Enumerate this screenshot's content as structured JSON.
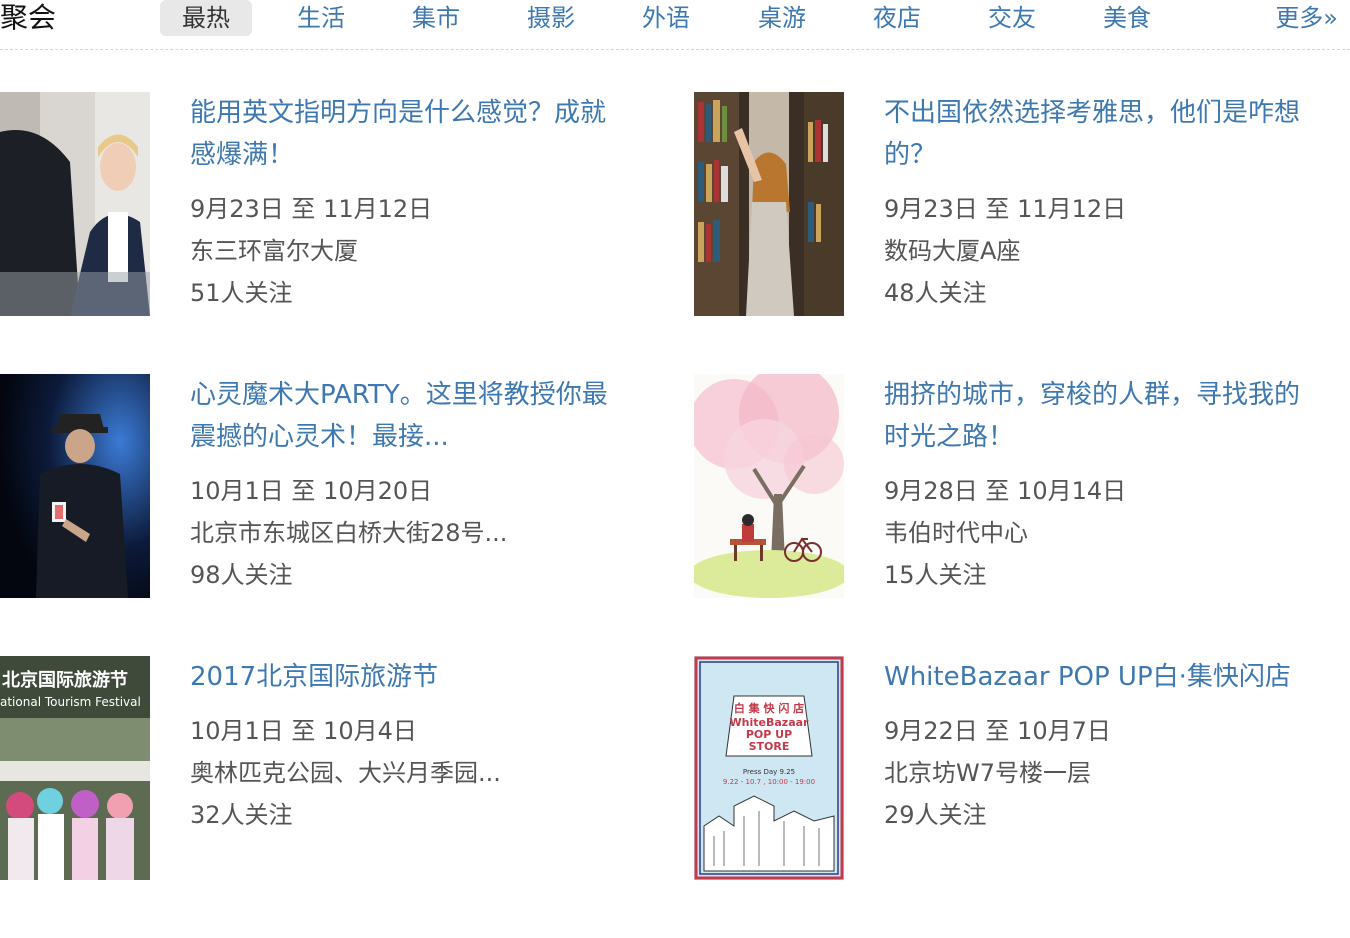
{
  "header": {
    "brand": "聚会",
    "tabs": [
      {
        "label": "最热",
        "active": true
      },
      {
        "label": "生活"
      },
      {
        "label": "集市"
      },
      {
        "label": "摄影"
      },
      {
        "label": "外语"
      },
      {
        "label": "桌游"
      },
      {
        "label": "夜店"
      },
      {
        "label": "交友"
      },
      {
        "label": "美食"
      }
    ],
    "more": "更多»"
  },
  "events": [
    {
      "title": "能用英文指明方向是什么感觉？成就感爆满！",
      "date": "9月23日 至 11月12日",
      "location": "东三环富尔大厦",
      "followers": "51人关注"
    },
    {
      "title": "不出国依然选择考雅思，他们是咋想的？",
      "date": "9月23日 至 11月12日",
      "location": "数码大厦A座",
      "followers": "48人关注"
    },
    {
      "title": "心灵魔术大PARTY。这里将教授你最震撼的心灵术！最接...",
      "date": "10月1日 至 10月20日",
      "location": "北京市东城区白桥大街28号...",
      "followers": "98人关注"
    },
    {
      "title": "拥挤的城市，穿梭的人群，寻找我的时光之路！",
      "date": "9月28日 至 10月14日",
      "location": "韦伯时代中心",
      "followers": "15人关注"
    },
    {
      "title": "2017北京国际旅游节",
      "date": "10月1日 至 10月4日",
      "location": "奥林匹克公园、大兴月季园...",
      "followers": "32人关注"
    },
    {
      "title": "WhiteBazaar POP UP白·集快闪店",
      "date": "9月22日 至 10月7日",
      "location": "北京坊W7号楼一层",
      "followers": "29人关注"
    }
  ],
  "posters": {
    "festival_cn": "北京国际旅游节",
    "festival_en": "ational Tourism Festival",
    "bazaar_cn": "白 集 快 闪 店",
    "bazaar_en_1": "WhiteBazaar",
    "bazaar_en_2": "POP UP",
    "bazaar_en_3": "STORE",
    "bazaar_date": "Press Day 9.25",
    "bazaar_range": "9.22 - 10.7 , 10:00 - 19:00"
  },
  "colors": {
    "link": "#3d78b0",
    "text": "#555555",
    "tab_active_bg": "#e8e8e8"
  }
}
